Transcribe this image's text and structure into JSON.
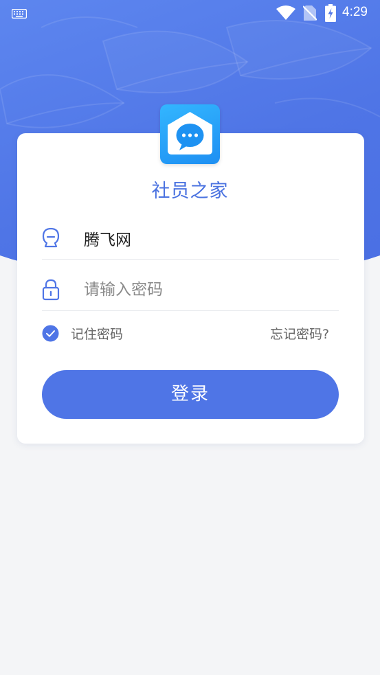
{
  "status_bar": {
    "time": "4:29",
    "icons": [
      "keyboard-icon",
      "wifi-icon",
      "no-sim-icon",
      "battery-charging-icon"
    ]
  },
  "app": {
    "title": "社员之家",
    "logo_icon": "chat-bubble-house-icon"
  },
  "login_form": {
    "username": {
      "icon": "user-avatar-icon",
      "value": "腾飞网",
      "placeholder": ""
    },
    "password": {
      "icon": "lock-icon",
      "value": "",
      "placeholder": "请输入密码"
    },
    "remember_label": "记住密码",
    "remember_checked": true,
    "forgot_label": "忘记密码?",
    "submit_label": "登录"
  },
  "colors": {
    "accent": "#4f75e6",
    "title": "#4a72e0",
    "logo": "#2aa6fb"
  }
}
